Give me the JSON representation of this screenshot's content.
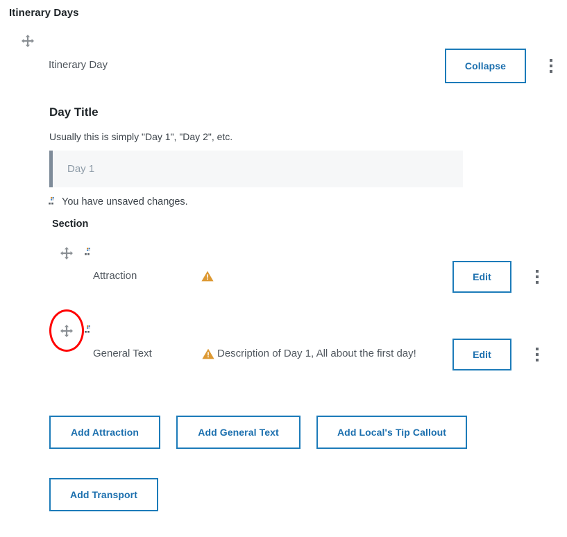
{
  "page": {
    "title": "Itinerary Days"
  },
  "itinerary_day": {
    "label": "Itinerary Day",
    "collapse_label": "Collapse",
    "menu_icon": "kebab-menu-icon",
    "drag_icon": "drag-move-icon"
  },
  "day_title_field": {
    "heading": "Day Title",
    "description": "Usually this is simply \"Day 1\", \"Day 2\", etc.",
    "value": "",
    "placeholder": "Day 1"
  },
  "unsaved_notice": {
    "icon": "broken-image-icon",
    "text": "You have unsaved changes."
  },
  "section": {
    "heading": "Section",
    "rows": [
      {
        "name": "Attraction",
        "warning_icon": "warning-triangle-icon",
        "preview": "",
        "edit_label": "Edit",
        "drag_icon": "drag-move-icon",
        "status_icon": "broken-image-icon",
        "menu_icon": "kebab-menu-icon"
      },
      {
        "name": "General Text",
        "warning_icon": "warning-triangle-icon",
        "preview": "Description of Day 1, All about the first day!",
        "edit_label": "Edit",
        "drag_icon": "drag-move-icon",
        "status_icon": "broken-image-icon",
        "menu_icon": "kebab-menu-icon"
      }
    ]
  },
  "add_buttons": [
    {
      "label": "Add Attraction"
    },
    {
      "label": "Add General Text"
    },
    {
      "label": "Add Local's Tip Callout"
    },
    {
      "label": "Add Transport"
    }
  ],
  "annotation": {
    "shape": "ellipse",
    "color": "#ff0000",
    "target": "drag-move-icon of General Text row"
  },
  "colors": {
    "accent_blue": "#1c7bb9",
    "link_blue": "#1b6fae",
    "warning_orange": "#dba617",
    "text_dark": "#1d2327",
    "text_body": "#3c434a",
    "text_muted": "#50575e",
    "input_bg": "#f6f7f8",
    "input_border_left": "#7e8b99",
    "annotation_red": "#ff0000"
  }
}
